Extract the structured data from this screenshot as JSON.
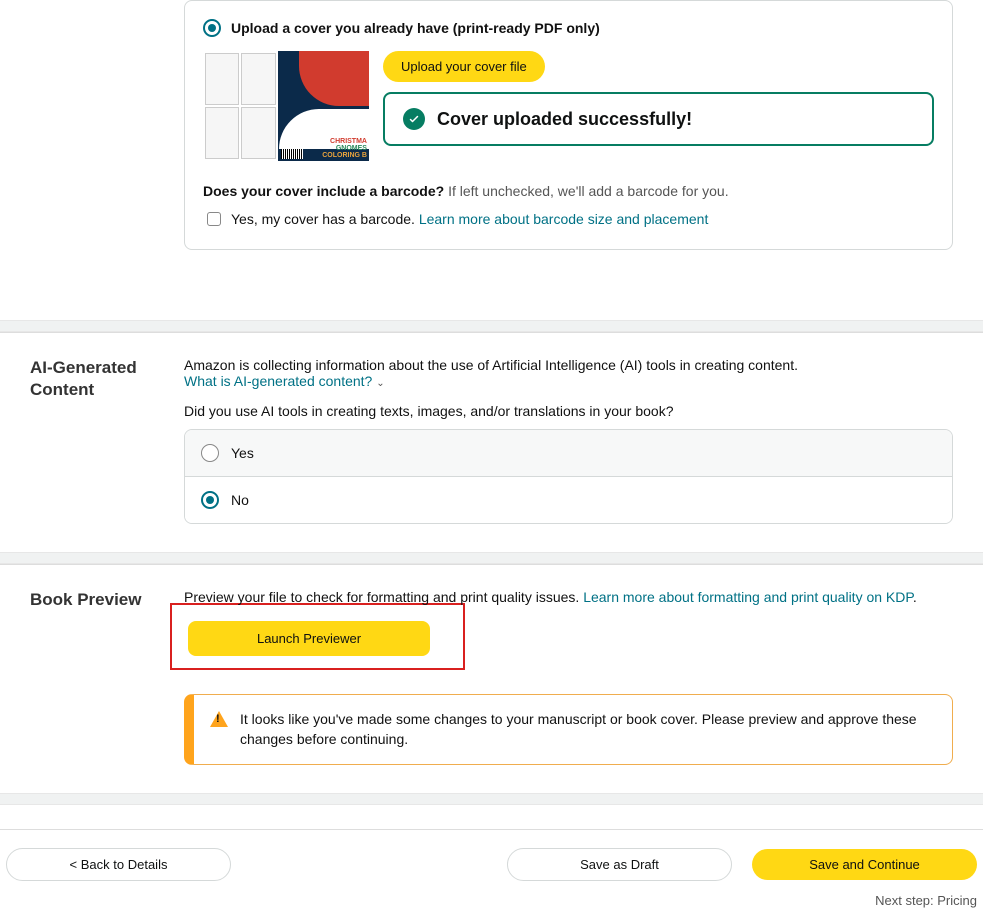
{
  "cover": {
    "radio_label": "Upload a cover you already have (print-ready PDF only)",
    "upload_button": "Upload your cover file",
    "success_message": "Cover uploaded successfully!",
    "barcode_question_bold": "Does your cover include a barcode?",
    "barcode_question_hint": " If left unchecked, we'll add a barcode for you.",
    "barcode_checkbox_label": "Yes, my cover has a barcode. ",
    "barcode_link": "Learn more about barcode size and placement",
    "thumb_line1": "CHRISTMA",
    "thumb_line2": "GNOMES",
    "thumb_line3": "COLORING B"
  },
  "ai": {
    "section_title": "AI-Generated Content",
    "intro": "Amazon is collecting information about the use of Artificial Intelligence (AI) tools in creating content.",
    "link": "What is AI-generated content?",
    "question": "Did you use AI tools in creating texts, images, and/or translations in your book?",
    "option_yes": "Yes",
    "option_no": "No"
  },
  "preview": {
    "section_title": "Book Preview",
    "text": "Preview your file to check for formatting and print quality issues. ",
    "link": "Learn more about formatting and print quality on KDP",
    "button": "Launch Previewer",
    "warning": "It looks like you've made some changes to your manuscript or book cover. Please preview and approve these changes before continuing."
  },
  "footer": {
    "back": "< Back to Details",
    "save_draft": "Save as Draft",
    "save_continue": "Save and Continue",
    "next_step": "Next step: Pricing"
  }
}
